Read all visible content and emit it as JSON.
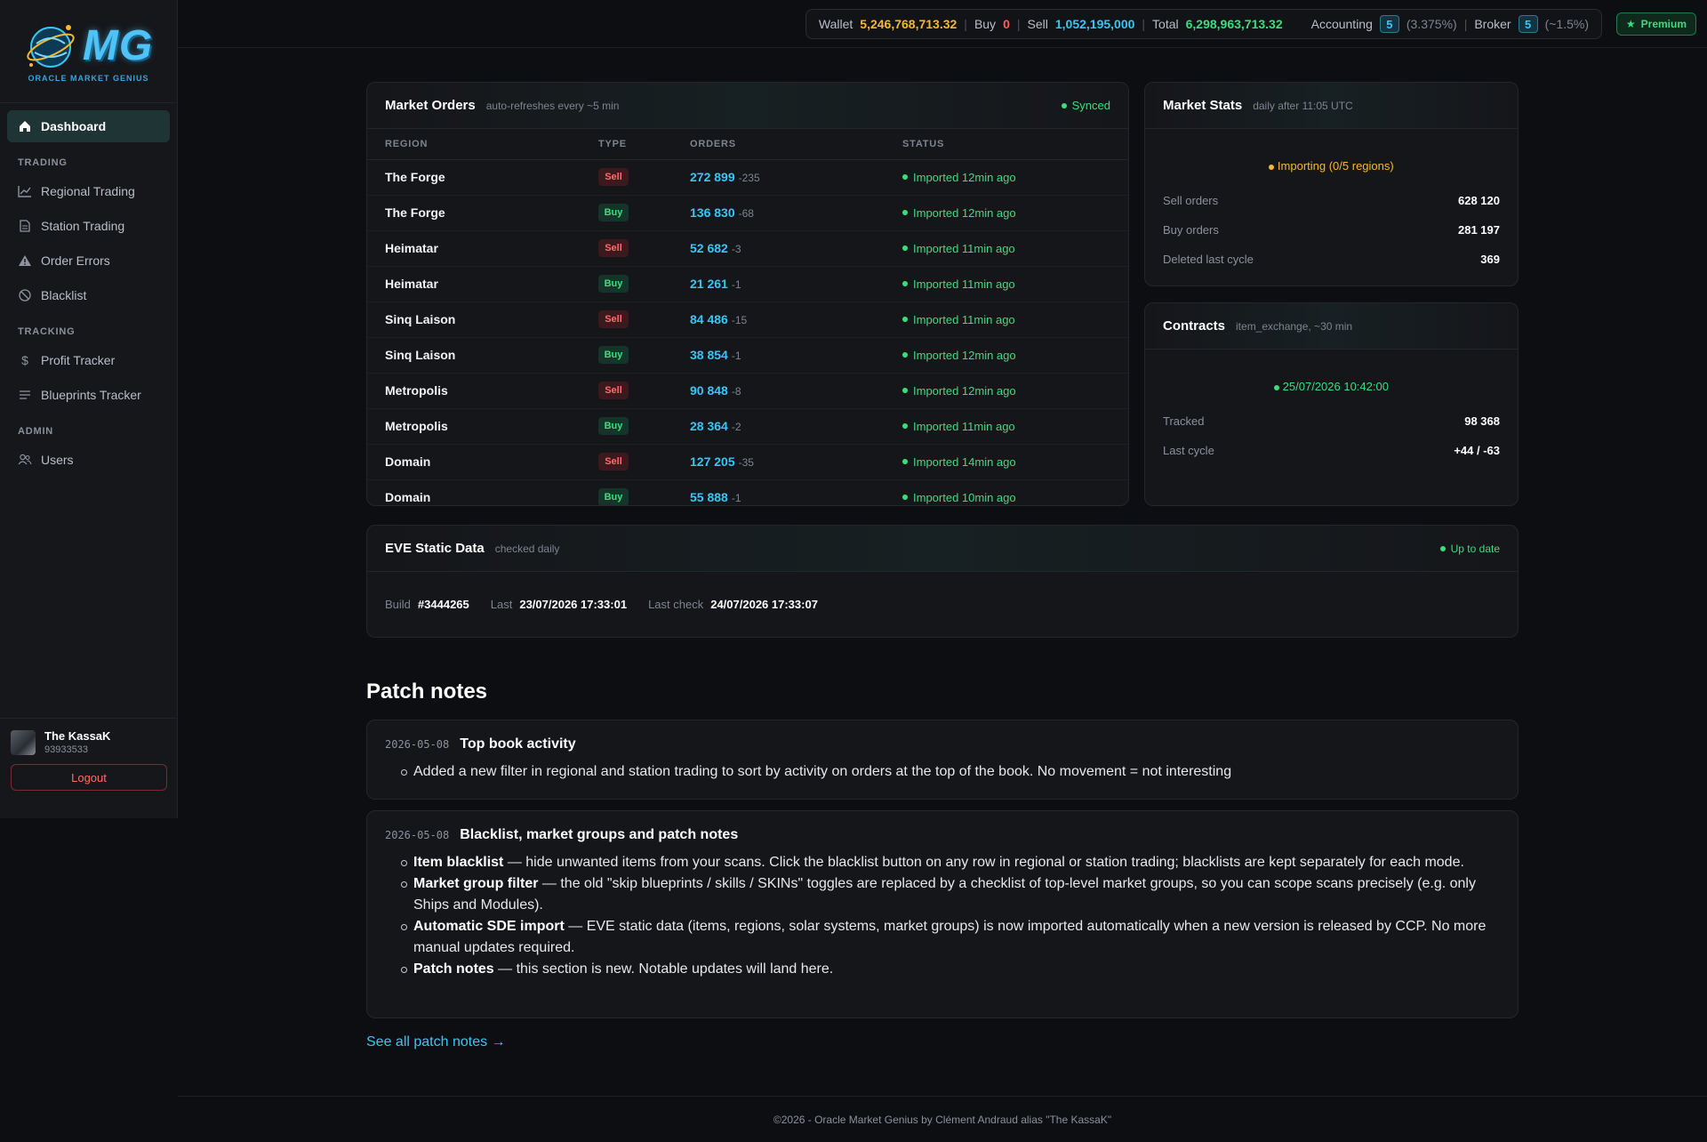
{
  "brand": {
    "logo_text": "MG",
    "logo_sub": "ORACLE MARKET GENIUS"
  },
  "sidebar": {
    "dashboard": "Dashboard",
    "sections": {
      "trading": "TRADING",
      "tracking": "TRACKING",
      "admin": "ADMIN"
    },
    "items": {
      "regional_trading": "Regional Trading",
      "station_trading": "Station Trading",
      "order_errors": "Order Errors",
      "blacklist": "Blacklist",
      "profit_tracker": "Profit Tracker",
      "blueprints_tracker": "Blueprints Tracker",
      "users": "Users"
    },
    "user": {
      "name": "The KassaK",
      "id": "93933533",
      "logout": "Logout"
    }
  },
  "topbar": {
    "wallet_label": "Wallet",
    "wallet_value": "5,246,768,713.32",
    "buy_label": "Buy",
    "buy_value": "0",
    "sell_label": "Sell",
    "sell_value": "1,052,195,000",
    "total_label": "Total",
    "total_value": "6,298,963,713.32",
    "accounting_label": "Accounting",
    "accounting_level": "5",
    "accounting_pct": "(3.375%)",
    "broker_label": "Broker",
    "broker_level": "5",
    "broker_pct": "(~1.5%)",
    "premium": "Premium"
  },
  "market_orders": {
    "title": "Market Orders",
    "subtitle": "auto-refreshes every ~5 min",
    "status": "Synced",
    "columns": [
      "REGION",
      "TYPE",
      "ORDERS",
      "STATUS"
    ],
    "rows": [
      {
        "region": "The Forge",
        "type": "Sell",
        "orders": "272 899",
        "delta": "-235",
        "status": "Imported 12min ago"
      },
      {
        "region": "The Forge",
        "type": "Buy",
        "orders": "136 830",
        "delta": "-68",
        "status": "Imported 12min ago"
      },
      {
        "region": "Heimatar",
        "type": "Sell",
        "orders": "52 682",
        "delta": "-3",
        "status": "Imported 11min ago"
      },
      {
        "region": "Heimatar",
        "type": "Buy",
        "orders": "21 261",
        "delta": "-1",
        "status": "Imported 11min ago"
      },
      {
        "region": "Sinq Laison",
        "type": "Sell",
        "orders": "84 486",
        "delta": "-15",
        "status": "Imported 11min ago"
      },
      {
        "region": "Sinq Laison",
        "type": "Buy",
        "orders": "38 854",
        "delta": "-1",
        "status": "Imported 12min ago"
      },
      {
        "region": "Metropolis",
        "type": "Sell",
        "orders": "90 848",
        "delta": "-8",
        "status": "Imported 12min ago"
      },
      {
        "region": "Metropolis",
        "type": "Buy",
        "orders": "28 364",
        "delta": "-2",
        "status": "Imported 11min ago"
      },
      {
        "region": "Domain",
        "type": "Sell",
        "orders": "127 205",
        "delta": "-35",
        "status": "Imported 14min ago"
      },
      {
        "region": "Domain",
        "type": "Buy",
        "orders": "55 888",
        "delta": "-1",
        "status": "Imported 10min ago"
      }
    ]
  },
  "market_stats": {
    "title": "Market Stats",
    "subtitle": "daily after 11:05 UTC",
    "status": "Importing (0/5 regions)",
    "rows": [
      {
        "label": "Sell orders",
        "value": "628 120"
      },
      {
        "label": "Buy orders",
        "value": "281 197"
      },
      {
        "label": "Deleted last cycle",
        "value": "369"
      }
    ]
  },
  "contracts": {
    "title": "Contracts",
    "subtitle": "item_exchange, ~30 min",
    "status": "25/07/2026 10:42:00",
    "rows": [
      {
        "label": "Tracked",
        "value": "98 368"
      },
      {
        "label": "Last cycle",
        "value": "+44 / -63"
      }
    ]
  },
  "sde": {
    "title": "EVE Static Data",
    "subtitle": "checked daily",
    "status": "Up to date",
    "build_label": "Build",
    "build_value": "#3444265",
    "last_label": "Last",
    "last_value": "23/07/2026 17:33:01",
    "check_label": "Last check",
    "check_value": "24/07/2026 17:33:07"
  },
  "patch_notes": {
    "heading": "Patch notes",
    "notes": [
      {
        "date": "2026-05-08",
        "title": "Top book activity",
        "items": [
          {
            "bold": "",
            "text": "Added a new filter in regional and station trading to sort by activity on orders at the top of the book. No movement = not interesting"
          }
        ]
      },
      {
        "date": "2026-05-08",
        "title": "Blacklist, market groups and patch notes",
        "items": [
          {
            "bold": "Item blacklist",
            "text": " — hide unwanted items from your scans. Click the blacklist button on any row in regional or station trading; blacklists are kept separately for each mode."
          },
          {
            "bold": "Market group filter",
            "text": " — the old \"skip blueprints / skills / SKINs\" toggles are replaced by a checklist of top-level market groups, so you can scope scans precisely (e.g. only Ships and Modules)."
          },
          {
            "bold": "Automatic SDE import",
            "text": " — EVE static data (items, regions, solar systems, market groups) is now imported automatically when a new version is released by CCP. No more manual updates required."
          },
          {
            "bold": "Patch notes",
            "text": " — this section is new. Notable updates will land here."
          }
        ]
      }
    ],
    "see_all": "See all patch notes →"
  },
  "footer": {
    "text": "©2026 - Oracle Market Genius by Clément Andraud alias \"The KassaK\""
  },
  "colors": {
    "accent": "#38c6f4",
    "success": "#3fdc7e",
    "danger": "#ff6b6b",
    "warning": "#f5b82e",
    "background": "#0d0e11",
    "panel": "#15161a"
  }
}
